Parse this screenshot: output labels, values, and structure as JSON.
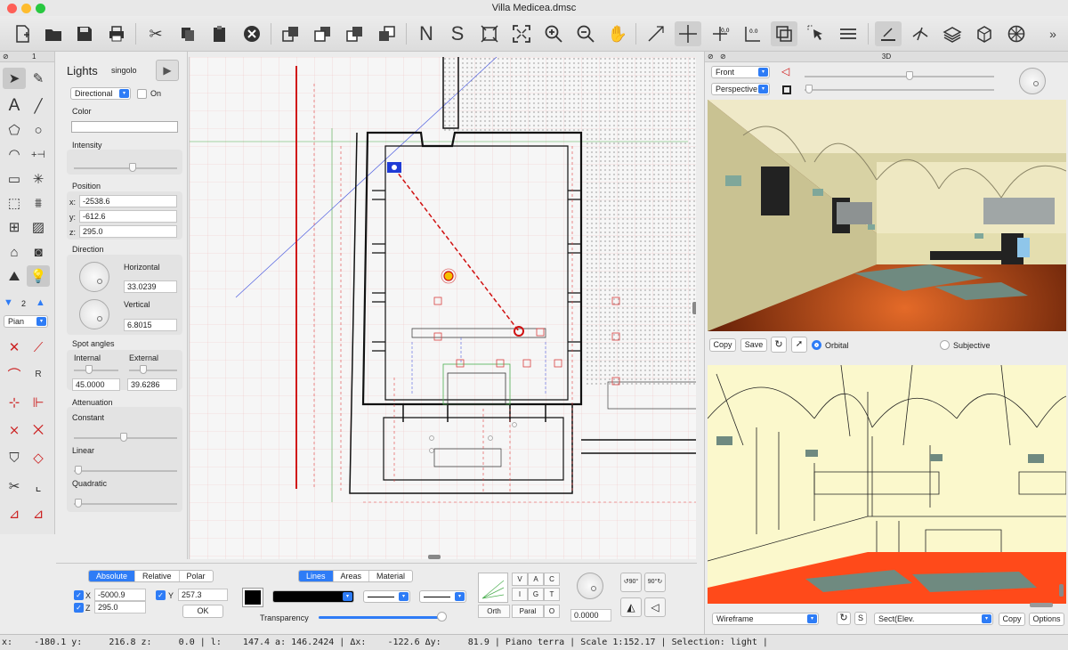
{
  "window": {
    "title": "Villa Medicea.dmsc"
  },
  "toolbar": {
    "buttons": [
      "new-file-icon",
      "open-folder-icon",
      "save-icon",
      "print-icon",
      "cut-icon",
      "copy-icon",
      "paste-icon",
      "delete-icon",
      "bring-front-icon",
      "send-back-icon",
      "bring-forward-icon",
      "send-backward-icon",
      "N",
      "S",
      "zoom-fit-icon",
      "zoom-extents-icon",
      "zoom-in-icon",
      "zoom-out-icon",
      "pan-hand-icon",
      "line-icon",
      "crosshair-icon",
      "origin-icon",
      "measure-icon",
      "group-icon",
      "select-icon",
      "layers-icon",
      "plane-icon",
      "plane-tilt-icon",
      "stack-icon",
      "cube-icon",
      "wheel-icon"
    ]
  },
  "palette": {
    "header": "1",
    "level": "2",
    "plan_label": "Pian"
  },
  "lights": {
    "title": "Lights",
    "name": "singolo",
    "type": "Directional",
    "on_label": "On",
    "color_label": "Color",
    "intensity_label": "Intensity",
    "position_label": "Position",
    "x_label": "x:",
    "x_value": "-2538.6",
    "y_label": "y:",
    "y_value": "-612.6",
    "z_label": "z:",
    "z_value": "295.0",
    "direction_label": "Direction",
    "horizontal_label": "Horizontal",
    "horizontal_value": "33.0239",
    "vertical_label": "Vertical",
    "vertical_value": "6.8015",
    "spot_label": "Spot angles",
    "internal_label": "Internal",
    "internal_value": "45.0000",
    "external_label": "External",
    "external_value": "39.6286",
    "attenuation_label": "Attenuation",
    "constant_label": "Constant",
    "linear_label": "Linear",
    "quadratic_label": "Quadratic"
  },
  "coords": {
    "tabs": [
      "Absolute",
      "Relative",
      "Polar"
    ],
    "x_label": "X",
    "x_value": "-5000.9",
    "y_label": "Y",
    "y_value": "257.3",
    "z_label": "Z",
    "z_value": "295.0",
    "ok_label": "OK"
  },
  "style": {
    "tabs": [
      "Lines",
      "Areas",
      "Material"
    ],
    "transparency_label": "Transparency",
    "grid_buttons": [
      "V",
      "A",
      "C",
      "I",
      "G",
      "T",
      "Orth",
      "Paral",
      "O"
    ],
    "angle_value": "0.0000"
  },
  "panel3d": {
    "title": "3D",
    "view_select": "Front",
    "projection_select": "Perspective",
    "copy_label": "Copy",
    "save_label": "Save",
    "orbital_label": "Orbital",
    "subjective_label": "Subjective",
    "render_mode": "Wireframe",
    "s_label": "S",
    "section_select": "Sect(Elev.",
    "copy2_label": "Copy",
    "options_label": "Options"
  },
  "status": {
    "text": "x:    -180.1 y:     216.8 z:     0.0 | l:    147.4 a: 146.2424 | Δx:    -122.6 Δy:     81.9 | Piano terra | Scale 1:152.17 | Selection: light |"
  },
  "colors": {
    "accent": "#2e7cf6",
    "floor": "#8a2c0c",
    "wall": "#e9e3b6",
    "wire_bg": "#fbf8cc",
    "wire_floor": "#ff4a1a"
  }
}
